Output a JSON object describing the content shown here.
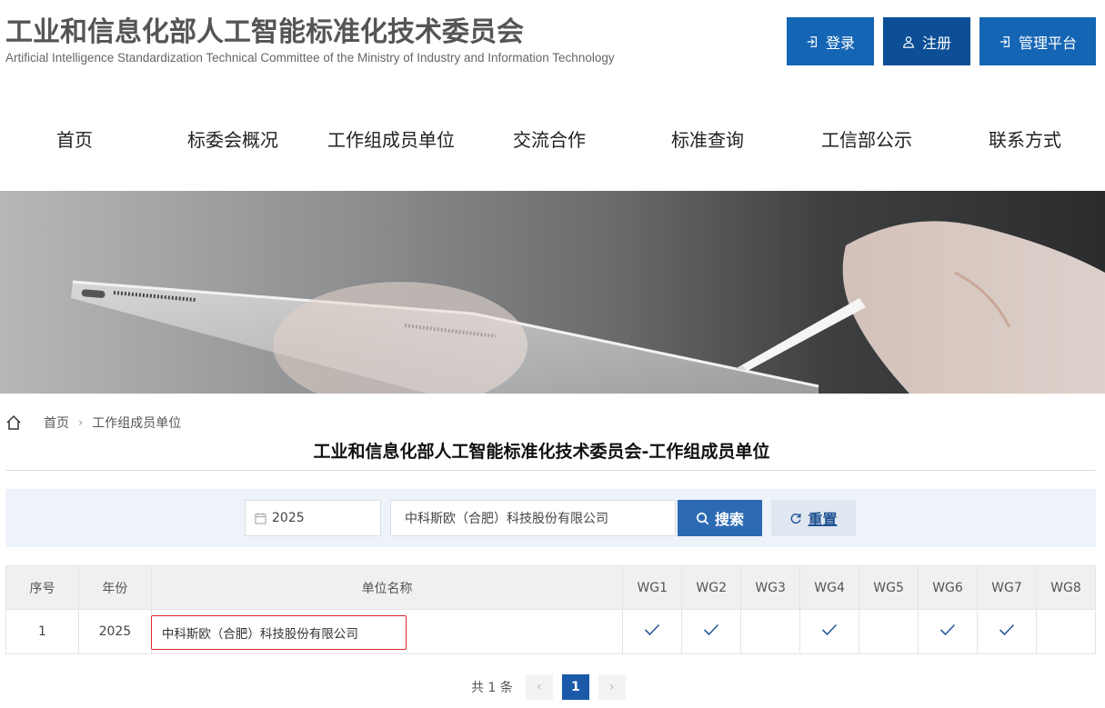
{
  "header": {
    "title": "工业和信息化部人工智能标准化技术委员会",
    "subtitle": "Artificial Intelligence Standardization Technical Committee of the Ministry of Industry and Information Technology",
    "buttons": {
      "login": "登录",
      "register": "注册",
      "admin": "管理平台"
    }
  },
  "nav": {
    "items": [
      "首页",
      "标委会概况",
      "工作组成员单位",
      "交流合作",
      "标准查询",
      "工信部公示",
      "联系方式"
    ]
  },
  "breadcrumb": {
    "home": "首页",
    "current": "工作组成员单位"
  },
  "page_title": "工业和信息化部人工智能标准化技术委员会-工作组成员单位",
  "search": {
    "year_value": "2025",
    "name_value": "中科斯欧（合肥）科技股份有限公司",
    "search_label": "搜索",
    "reset_label": "重置"
  },
  "table": {
    "headers": [
      "序号",
      "年份",
      "单位名称",
      "WG1",
      "WG2",
      "WG3",
      "WG4",
      "WG5",
      "WG6",
      "WG7",
      "WG8"
    ],
    "rows": [
      {
        "index": "1",
        "year": "2025",
        "name": "中科斯欧（合肥）科技股份有限公司",
        "wg": [
          true,
          true,
          false,
          true,
          false,
          true,
          true,
          false
        ]
      }
    ]
  },
  "pagination": {
    "total": "共 1 条",
    "current_page": "1"
  },
  "colors": {
    "primary": "#1565b5",
    "primary_dark": "#0d4f96",
    "highlight": "#d9272b",
    "panel": "#eef3f9"
  }
}
